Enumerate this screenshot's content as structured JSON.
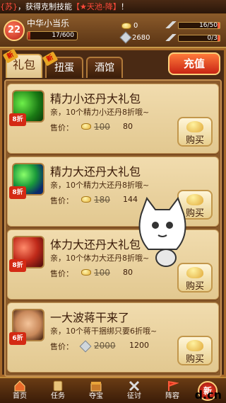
{
  "ticker": {
    "prefix": "{苏}",
    "message": "，获得克制技能",
    "skill": "【★天池-降】",
    "suffix": "！"
  },
  "player": {
    "level": "22",
    "name": "中华小当乐",
    "exp_text": "17/600",
    "exp_fraction": 0.028
  },
  "resources": {
    "gold": "0",
    "silver": "2680",
    "stamina": "16/50",
    "military": "0/3",
    "stamina_fraction": 0.32
  },
  "tabs": [
    {
      "label": "礼包",
      "new": "新"
    },
    {
      "label": "扭蛋",
      "new": "新"
    },
    {
      "label": "酒馆"
    }
  ],
  "recharge_label": "充值",
  "price_label": "售价：",
  "buy_label": "购买",
  "items": [
    {
      "title": "精力小还丹大礼包",
      "desc": "亲，10个精力小还丹8折哦~",
      "discount": "8折",
      "old": "100",
      "new": "80",
      "currency": "gold"
    },
    {
      "title": "精力大还丹大礼包",
      "desc": "亲，10个精力大还丹8折哦~",
      "discount": "8折",
      "old": "180",
      "new": "144",
      "currency": "gold"
    },
    {
      "title": "体力大还丹大礼包",
      "desc": "亲，10个体力大还丹8折哦~",
      "discount": "8折",
      "old": "100",
      "new": "80",
      "currency": "gold"
    },
    {
      "title": "一大波蒋干来了",
      "desc": "亲，10个蒋干捆绑只要6折哦~",
      "discount": "6折",
      "old": "2000",
      "new": "1200",
      "currency": "silver"
    }
  ],
  "nav": [
    {
      "label": "首页"
    },
    {
      "label": "任务"
    },
    {
      "label": "夺宝"
    },
    {
      "label": "征讨"
    },
    {
      "label": "阵容"
    },
    {
      "label": "新"
    }
  ],
  "watermark": "d.cn",
  "colors": {
    "accent": "#c82414",
    "card": "#f1dcae",
    "frame": "#a6692a"
  }
}
